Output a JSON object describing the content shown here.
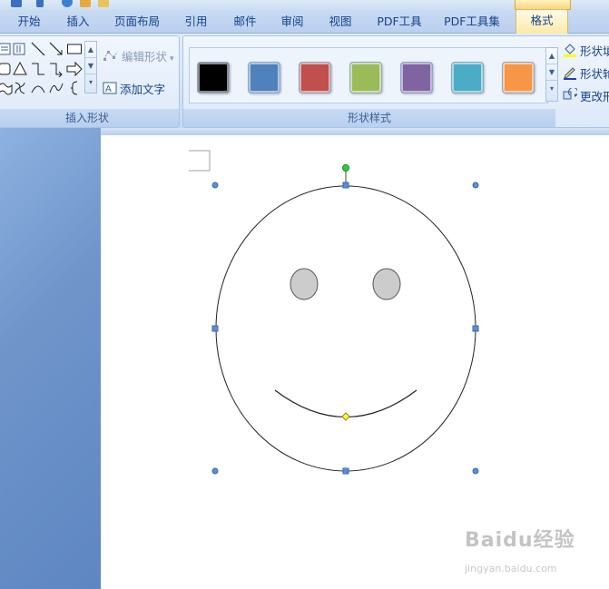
{
  "ribbon": {
    "tabs": [
      {
        "label": "开始"
      },
      {
        "label": "插入"
      },
      {
        "label": "页面布局"
      },
      {
        "label": "引用"
      },
      {
        "label": "邮件"
      },
      {
        "label": "审阅"
      },
      {
        "label": "视图"
      },
      {
        "label": "PDF工具"
      },
      {
        "label": "PDF工具集"
      },
      {
        "label": "格式",
        "active": true
      }
    ],
    "insert_shapes": {
      "edit_shape_label": "编辑形状",
      "add_text_label": "添加文字",
      "group_label": "插入形状"
    },
    "shape_styles": {
      "group_label": "形状样式",
      "swatches": [
        "#000000",
        "#4f81bd",
        "#c0504d",
        "#9bbb59",
        "#8064a2",
        "#4bacc6",
        "#f79646"
      ],
      "fill_label": "形状填",
      "outline_label": "形状轮",
      "change_label": "更改形"
    }
  },
  "watermark": {
    "brand": "Baidu经验",
    "url": "jingyan.baidu.com"
  },
  "colors": {
    "accent": "#15428b",
    "selection_handle": "#5b8ed6",
    "rotate_handle": "#2ecc40",
    "adjust_handle": "#ffff44",
    "eye_fill": "#cccccc"
  }
}
